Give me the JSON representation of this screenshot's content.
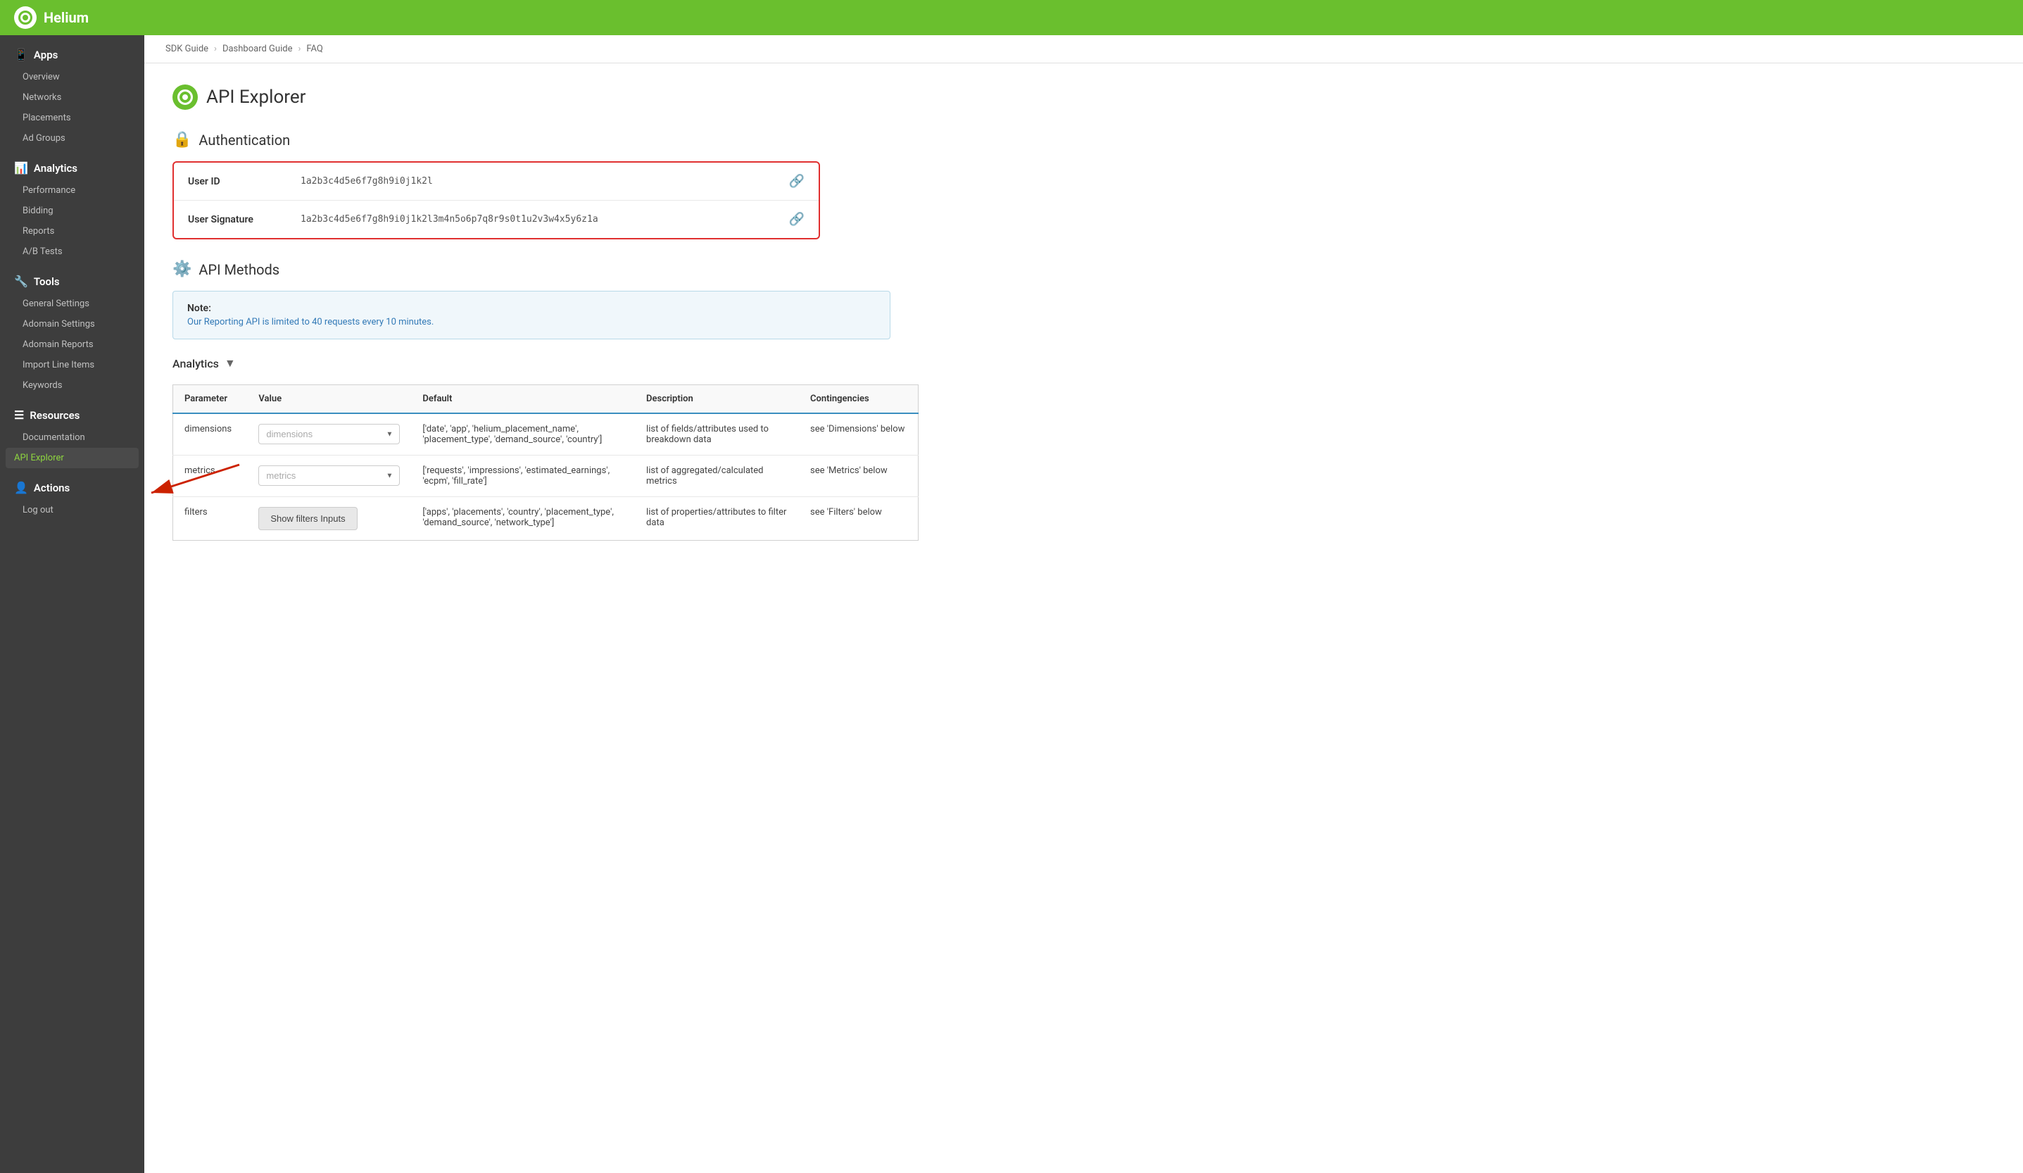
{
  "topbar": {
    "title": "Helium"
  },
  "breadcrumb": {
    "items": [
      "SDK Guide",
      "Dashboard Guide",
      "FAQ"
    ]
  },
  "sidebar": {
    "apps_section": "Apps",
    "apps_items": [
      "Overview",
      "Networks",
      "Placements",
      "Ad Groups"
    ],
    "analytics_section": "Analytics",
    "analytics_items": [
      "Performance",
      "Bidding",
      "Reports",
      "A/B Tests"
    ],
    "tools_section": "Tools",
    "tools_items": [
      "General Settings",
      "Adomain Settings",
      "Adomain Reports",
      "Import Line Items",
      "Keywords"
    ],
    "resources_section": "Resources",
    "resources_items": [
      "Documentation",
      "API Explorer"
    ],
    "actions_section": "Actions",
    "actions_items": [
      "Log out"
    ]
  },
  "page": {
    "title": "API Explorer"
  },
  "authentication": {
    "section_title": "Authentication",
    "user_id_label": "User ID",
    "user_id_value": "1a2b3c4d5e6f7g8h9i0j1k2l",
    "user_sig_label": "User Signature",
    "user_sig_value": "1a2b3c4d5e6f7g8h9i0j1k2l3m4n5o6p7q8r9s0t1u2v3w4x5y6z1a"
  },
  "api_methods": {
    "section_title": "API Methods",
    "note_title": "Note:",
    "note_text": "Our Reporting API is limited to 40 requests every 10 minutes.",
    "analytics_label": "Analytics",
    "table": {
      "headers": [
        "Parameter",
        "Value",
        "Default",
        "Description",
        "Contingencies"
      ],
      "rows": [
        {
          "parameter": "dimensions",
          "value_placeholder": "dimensions",
          "default": "['date', 'app', 'helium_placement_name', 'placement_type', 'demand_source', 'country']",
          "description": "list of fields/attributes used to breakdown data",
          "contingencies": "see 'Dimensions' below"
        },
        {
          "parameter": "metrics",
          "value_placeholder": "metrics",
          "default": "['requests', 'impressions', 'estimated_earnings', 'ecpm', 'fill_rate']",
          "description": "list of aggregated/calculated metrics",
          "contingencies": "see 'Metrics' below"
        },
        {
          "parameter": "filters",
          "value_button": "Show filters Inputs",
          "default": "['apps', 'placements', 'country', 'placement_type', 'demand_source', 'network_type']",
          "description": "list of properties/attributes to filter data",
          "contingencies": "see 'Filters' below"
        }
      ]
    }
  }
}
